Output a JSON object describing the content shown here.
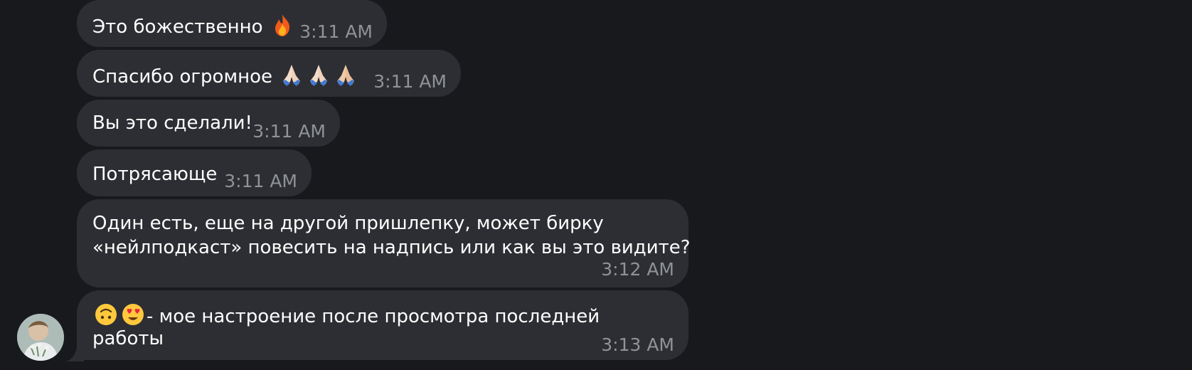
{
  "messages": [
    {
      "text": "Это божественно",
      "emojis": [
        "fire-emoji"
      ],
      "time": "3:11 AM"
    },
    {
      "text": "Спасибо огромное",
      "emojis": [
        "praying-hands-emoji",
        "praying-hands-emoji",
        "praying-hands-emoji"
      ],
      "time": "3:11 AM"
    },
    {
      "text": "Вы это сделали!",
      "time": "3:11 AM"
    },
    {
      "text": "Потрясающе",
      "time": "3:11 AM"
    },
    {
      "line1": "Один есть, еще на другой пришлепку, может бирку",
      "line2": "«нейлподкаст» повесить на надпись или как вы это видите?",
      "time": "3:12 AM"
    },
    {
      "emojis": [
        "upside-down-face-emoji",
        "heart-eyes-emoji"
      ],
      "line1": "- мое настроение после просмотра последней",
      "line2": "работы",
      "time": "3:13 AM"
    }
  ],
  "colors": {
    "background": "#18191d",
    "bubble": "#2c2e33",
    "text": "#ffffff",
    "time": "#8f9296"
  }
}
